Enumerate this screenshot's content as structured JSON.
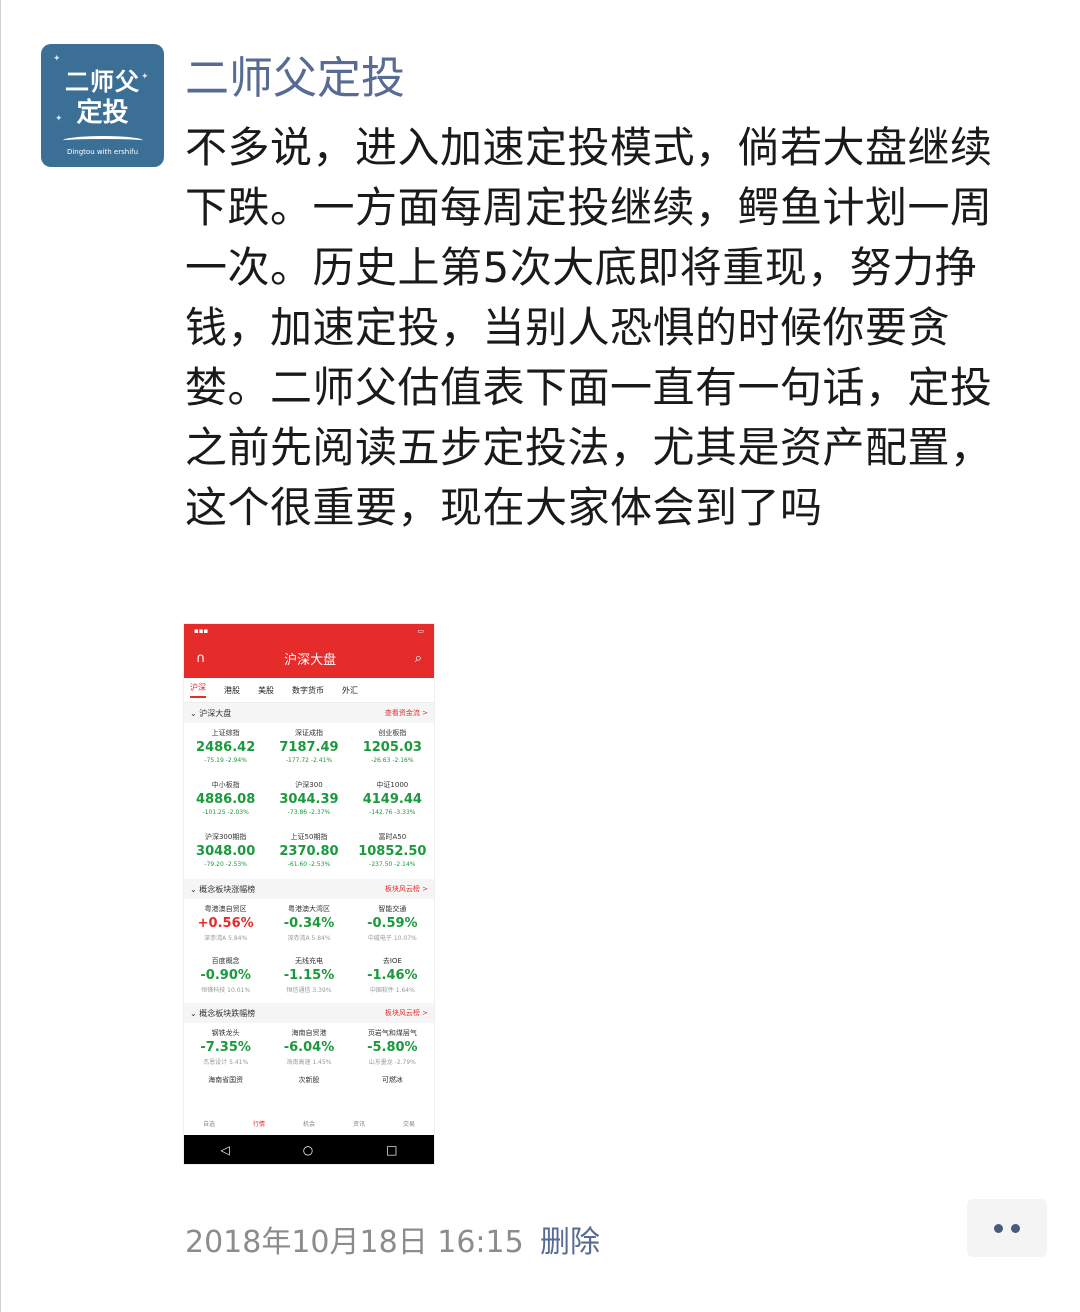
{
  "post": {
    "nickname": "二师父定投",
    "text": "不多说，进入加速定投模式，倘若大盘继续下跌。一方面每周定投继续，鳄鱼计划一周一次。历史上第5次大底即将重现，努力挣钱，加速定投，当别人恐惧的时候你要贪婪。二师父估值表下面一直有一句话，定投之前先阅读五步定投法，尤其是资产配置，这个很重要，现在大家体会到了吗",
    "timestamp": "2018年10月18日 16:15",
    "delete_label": "删除"
  },
  "avatar": {
    "line1": "二师父",
    "line2": "定投",
    "sub": "Dingtou with ershifu"
  },
  "colors": {
    "link": "#576b95",
    "brand_red": "#e62b2b",
    "down_green": "#1a9a3c"
  },
  "screenshot": {
    "title": "沪深大盘",
    "tabs": [
      "沪深",
      "港股",
      "美股",
      "数字货币",
      "外汇"
    ],
    "section1": {
      "title": "沪深大盘",
      "link": "查看资金流 >"
    },
    "indices": [
      {
        "name": "上证综指",
        "value": "2486.42",
        "change": "-75.19  -2.94%"
      },
      {
        "name": "深证成指",
        "value": "7187.49",
        "change": "-177.72  -2.41%"
      },
      {
        "name": "创业板指",
        "value": "1205.03",
        "change": "-26.63  -2.16%"
      },
      {
        "name": "中小板指",
        "value": "4886.08",
        "change": "-101.25  -2.03%"
      },
      {
        "name": "沪深300",
        "value": "3044.39",
        "change": "-73.86  -2.37%"
      },
      {
        "name": "中证1000",
        "value": "4149.44",
        "change": "-142.76  -3.33%"
      },
      {
        "name": "沪深300期指",
        "value": "3048.00",
        "change": "-79.20  -2.53%"
      },
      {
        "name": "上证50期指",
        "value": "2370.80",
        "change": "-61.60  -2.53%"
      },
      {
        "name": "富时A50",
        "value": "10852.50",
        "change": "-237.50  -2.14%"
      }
    ],
    "section2": {
      "title": "概念板块涨幅榜",
      "link": "板块风云榜 >"
    },
    "gainers": [
      {
        "name": "粤港澳自贸区",
        "value": "+0.56%",
        "sub": "深赤湾A 5.84%",
        "up": true
      },
      {
        "name": "粤港澳大湾区",
        "value": "-0.34%",
        "sub": "深赤湾A 5.84%",
        "up": false
      },
      {
        "name": "智能交通",
        "value": "-0.59%",
        "sub": "中威电子 10.07%",
        "up": false
      },
      {
        "name": "百度概念",
        "value": "-0.90%",
        "sub": "恒锋科技 10.01%",
        "up": false
      },
      {
        "name": "无线充电",
        "value": "-1.15%",
        "sub": "恒信通信 3.39%",
        "up": false
      },
      {
        "name": "去IOE",
        "value": "-1.46%",
        "sub": "中国软件 1.64%",
        "up": false
      }
    ],
    "section3": {
      "title": "概念板块跌幅榜",
      "link": "板块风云榜 >"
    },
    "losers": [
      {
        "name": "钢铁龙头",
        "value": "-7.35%",
        "sub": "杰恩设计 5.41%"
      },
      {
        "name": "海南自贸港",
        "value": "-6.04%",
        "sub": "海南高速 1.45%"
      },
      {
        "name": "页岩气和煤层气",
        "value": "-5.80%",
        "sub": "山东墨龙 -2.79%"
      }
    ],
    "more_rows": [
      "海南省国资",
      "次新股",
      "可燃冰"
    ],
    "bottom_nav": [
      "自选",
      "行情",
      "机会",
      "资讯",
      "交易"
    ]
  }
}
